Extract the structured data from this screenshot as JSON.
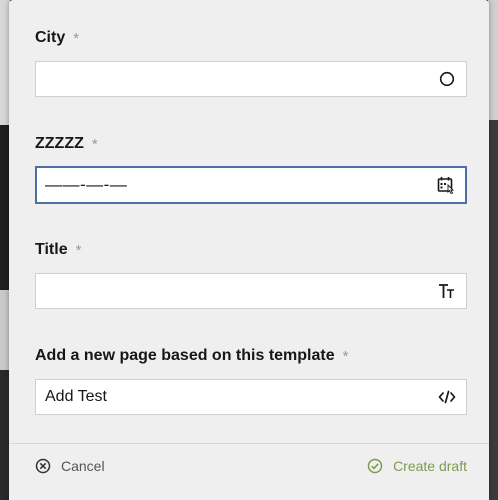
{
  "fields": {
    "city": {
      "label": "City",
      "required": "*",
      "value": ""
    },
    "zzzzz": {
      "label": "ZZZZZ",
      "required": "*",
      "mask": "——-—-—"
    },
    "title": {
      "label": "Title",
      "required": "*",
      "value": ""
    },
    "template": {
      "label": "Add a new page based on this template",
      "required": "*",
      "value": "Add Test"
    }
  },
  "footer": {
    "cancel_label": "Cancel",
    "create_label": "Create draft"
  },
  "colors": {
    "create_accent": "#7d9b50",
    "focus_border": "#4c6fa6"
  },
  "icons": [
    "circle-icon",
    "calendar-icon",
    "text-type-icon",
    "code-icon",
    "close-circle-icon",
    "check-circle-icon"
  ]
}
